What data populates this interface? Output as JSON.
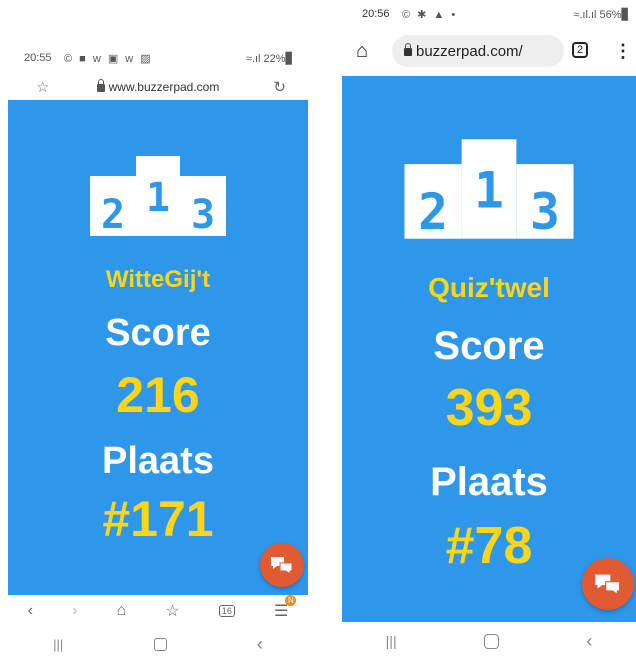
{
  "left_screen": {
    "status": {
      "time": "20:55",
      "icons": "© ■ w ▣ w ▨",
      "battery": "≈.ıl 22%▊"
    },
    "url": "www.buzzerpad.com",
    "team_name": "WitteGij't",
    "score_label": "Score",
    "score_value": "216",
    "rank_label": "Plaats",
    "rank_value": "#171",
    "tabs_count": "16",
    "menu_badge": "N",
    "podium": [
      "2",
      "1",
      "3"
    ]
  },
  "right_screen": {
    "status": {
      "time": "20:56",
      "icons": "© ✱ ▲ •",
      "battery": "≈.ıl.ıl 56%▊"
    },
    "url": "buzzerpad.com/",
    "tabs_count": "2",
    "team_name": "Quiz'twel",
    "score_label": "Score",
    "score_value": "393",
    "rank_label": "Plaats",
    "rank_value": "#78",
    "podium": [
      "2",
      "1",
      "3"
    ]
  },
  "colors": {
    "background_blue": "#2f97ea",
    "accent_yellow": "#ffd51a",
    "chat_orange": "#e05a34"
  }
}
